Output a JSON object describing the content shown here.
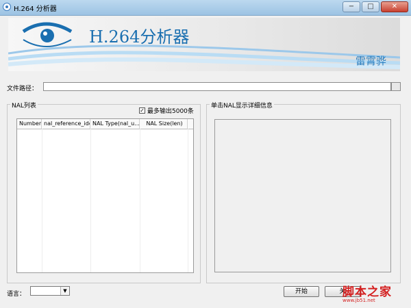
{
  "window": {
    "title": "H.264 分析器",
    "minimize": "−",
    "maximize": "□",
    "close": "✕"
  },
  "banner": {
    "title": "H.264分析器",
    "author": "雷霄骅"
  },
  "file_path": {
    "label": "文件路径：",
    "value": ""
  },
  "nal_list": {
    "legend": "NAL列表",
    "max_output_label": "最多输出5000条",
    "max_output_checked": true,
    "check_mark": "✓",
    "columns": [
      "Number",
      "nal_reference_idc",
      "NAL Type(nal_u...",
      "NAL Size(len)"
    ],
    "rows": []
  },
  "detail": {
    "legend": "单击NAL显示详细信息",
    "content": ""
  },
  "language": {
    "label": "语言：",
    "selected": "",
    "arrow": "▼"
  },
  "buttons": {
    "start": "开始",
    "close": "关"
  },
  "watermark": {
    "text": "脚本之家",
    "url": "www.jb51.net"
  },
  "colors": {
    "accent": "#1a6fb0",
    "titlebar": "#a9cbe8",
    "watermark": "#d42020"
  }
}
